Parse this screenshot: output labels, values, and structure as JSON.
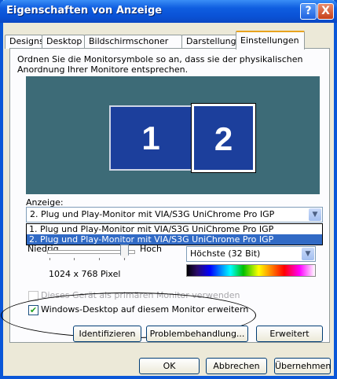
{
  "window": {
    "title": "Eigenschaften von Anzeige",
    "help_label": "?",
    "close_label": "X"
  },
  "tabs": [
    {
      "label": "Designs"
    },
    {
      "label": "Desktop"
    },
    {
      "label": "Bildschirmschoner"
    },
    {
      "label": "Darstellung"
    },
    {
      "label": "Einstellungen",
      "active": true
    }
  ],
  "settings": {
    "description": "Ordnen Sie die Monitorsymbole so an, dass sie der physikalischen Anordnung Ihrer Monitore entsprechen.",
    "monitors": [
      {
        "label": "1"
      },
      {
        "label": "2",
        "selected": true
      }
    ],
    "display_label": "Anzeige:",
    "display_value": "2. Plug und Play-Monitor mit VIA/S3G UniChrome Pro IGP",
    "display_options": [
      "1. Plug und Play-Monitor mit VIA/S3G UniChrome Pro IGP",
      "2. Plug und Play-Monitor mit VIA/S3G UniChrome Pro IGP"
    ],
    "resolution": {
      "low_label": "Niedrig",
      "high_label": "Hoch",
      "value": "1024 x 768 Pixel"
    },
    "color_quality": {
      "value": "Höchste (32 Bit)"
    },
    "primary_checkbox": {
      "label": "Dieses Gerät als primären Monitor verwenden",
      "checked": false
    },
    "extend_checkbox": {
      "label": "Windows-Desktop auf diesem Monitor erweitern",
      "checked": true
    }
  },
  "buttons": {
    "identify": "Identifizieren",
    "troubleshoot": "Problembehandlung...",
    "advanced": "Erweitert",
    "ok": "OK",
    "cancel": "Abbrechen",
    "apply": "Übernehmen"
  },
  "colors": {
    "titlebar": "#0a52d6",
    "monitor_fill": "#1c3f9c",
    "preview_bg": "#3d6b77",
    "selection": "#316ac5"
  }
}
